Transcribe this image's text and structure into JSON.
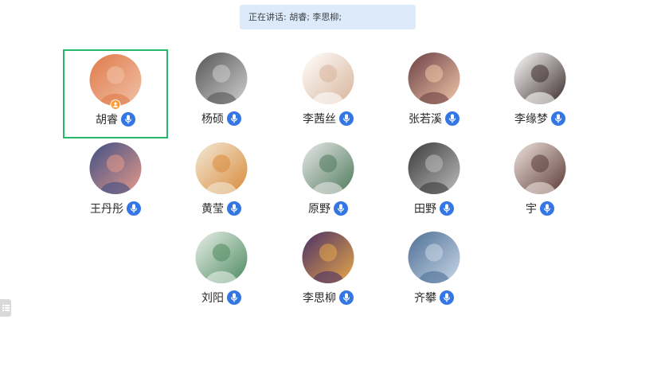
{
  "speaking_banner": "正在讲话: 胡睿; 李思柳;",
  "participants": [
    {
      "name": "胡睿",
      "avatar": "cartoon-cat-illustration",
      "colors": [
        "#e07a4a",
        "#f0c2a8"
      ],
      "host": true,
      "active_speaker": true
    },
    {
      "name": "杨硕",
      "avatar": "monochrome-photo",
      "colors": [
        "#555555",
        "#cfcfcf"
      ]
    },
    {
      "name": "李茜丝",
      "avatar": "cartoon-girl-sticker",
      "colors": [
        "#ffffff",
        "#d8b49a"
      ]
    },
    {
      "name": "张若溪",
      "avatar": "illustrated-girl-portrait",
      "colors": [
        "#6a3f45",
        "#f2c7a8"
      ]
    },
    {
      "name": "李缘梦",
      "avatar": "chibi-sticker",
      "colors": [
        "#ffffff",
        "#3a2a2a"
      ]
    },
    {
      "name": "王丹彤",
      "avatar": "sunset-sky-photo",
      "colors": [
        "#3e4f86",
        "#e69a88"
      ]
    },
    {
      "name": "黄莹",
      "avatar": "illustrated-girl-with-tea",
      "colors": [
        "#f2ead8",
        "#d98a3a"
      ]
    },
    {
      "name": "原野",
      "avatar": "sketch-figure-on-bench",
      "colors": [
        "#e8e8e8",
        "#4f7a5c"
      ]
    },
    {
      "name": "田野",
      "avatar": "bw-street-photo",
      "colors": [
        "#3a3a3a",
        "#bdbdbd"
      ]
    },
    {
      "name": "宇",
      "avatar": "selfie-photo",
      "colors": [
        "#efe2dd",
        "#5a3a35"
      ]
    },
    {
      "name": "刘阳",
      "avatar": "cat-doodle",
      "colors": [
        "#e9efe9",
        "#4c8a5f"
      ]
    },
    {
      "name": "李思柳",
      "avatar": "burger-planet-illustration",
      "colors": [
        "#4a2f66",
        "#e8a84a"
      ]
    },
    {
      "name": "齐攀",
      "avatar": "ocean-aerial-photo",
      "colors": [
        "#4d6f97",
        "#c9d7e6"
      ]
    }
  ],
  "colors": {
    "banner_bg": "#dceaf9",
    "active_border": "#25b86b",
    "mic_blue": "#3476e4",
    "host_orange": "#ff9a2e"
  },
  "icons": {
    "mic": "mic-icon",
    "host": "host-badge-icon",
    "side_handle": "list-icon"
  }
}
